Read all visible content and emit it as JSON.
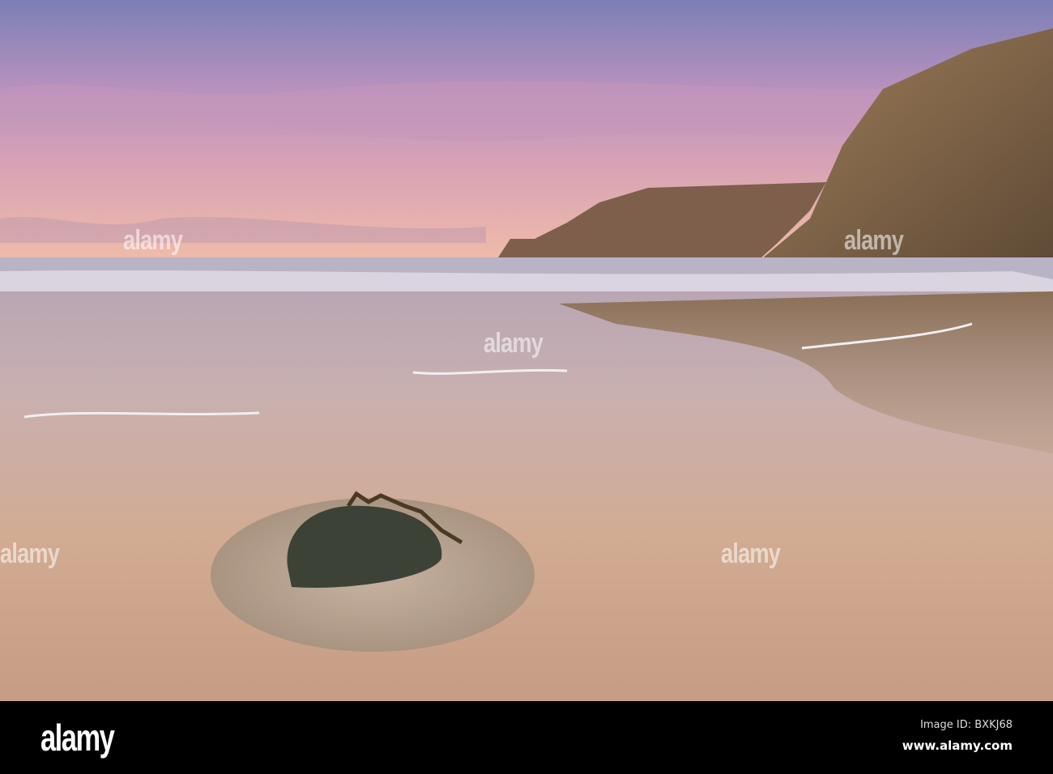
{
  "image": {
    "subject": "beach-at-dusk-with-rock-and-cliffs",
    "colors": {
      "sky_top": "#7f83b8",
      "sky_mid": "#c79ab8",
      "horizon": "#f0b9a8",
      "sand": "#c9a58e",
      "cliff": "#8a6a4a",
      "rock": "#3c4036"
    }
  },
  "watermark": {
    "text": "alamy"
  },
  "footer": {
    "logo": "alamy",
    "image_id": "Image ID: BXKJ68",
    "url": "www.alamy.com"
  }
}
